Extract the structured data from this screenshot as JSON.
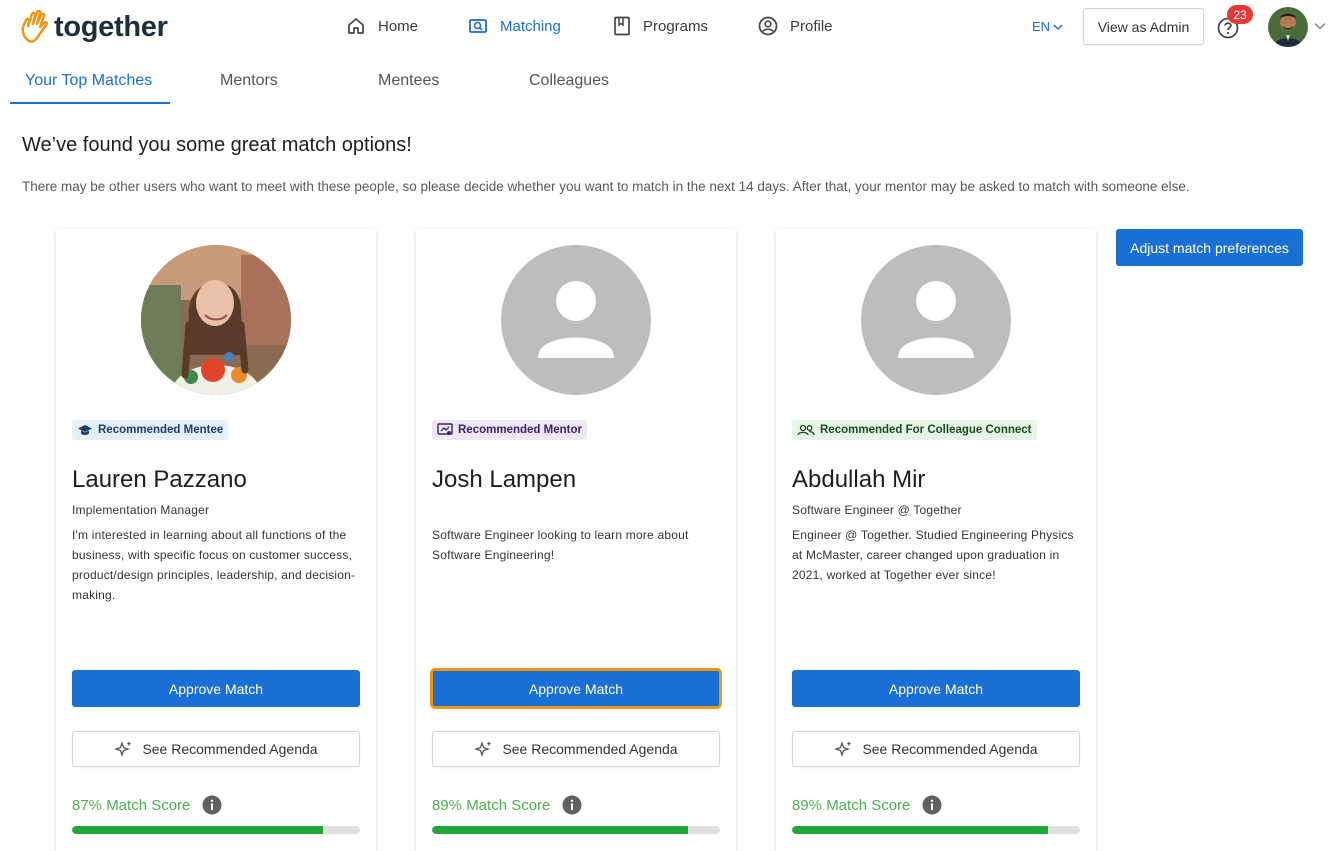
{
  "brand": {
    "name": "together",
    "accent": "#1a6fd4",
    "logo_color": "#f0950f"
  },
  "nav": {
    "items": [
      {
        "label": "Home",
        "icon": "home-icon",
        "active": false
      },
      {
        "label": "Matching",
        "icon": "matching-icon",
        "active": true
      },
      {
        "label": "Programs",
        "icon": "book-icon",
        "active": false
      },
      {
        "label": "Profile",
        "icon": "profile-icon",
        "active": false
      }
    ],
    "language": "EN",
    "admin_button": "View as Admin",
    "notification_count": "23"
  },
  "tabs": [
    {
      "label": "Your Top Matches",
      "active": true
    },
    {
      "label": "Mentors",
      "active": false
    },
    {
      "label": "Mentees",
      "active": false
    },
    {
      "label": "Colleagues",
      "active": false
    }
  ],
  "main": {
    "headline": "We’ve found you some great match options!",
    "subline": "There may be other users who want to meet with these people, so please decide whether you want to match in the next 14 days. After that, your mentor may be asked to match with someone else.",
    "adjust_button": "Adjust match preferences"
  },
  "cards": [
    {
      "tag": "Recommended Mentee",
      "tag_icon": "graduation-cap-icon",
      "name": "Lauren Pazzano",
      "role": "Implementation Manager",
      "bio": "I'm interested in learning about all functions of the business, with specific focus on customer success, product/design principles, leadership, and decision-making.",
      "approve_label": "Approve Match",
      "agenda_label": "See Recommended Agenda",
      "score_label": "87% Match Score",
      "score": 0.87,
      "has_photo": true
    },
    {
      "tag": "Recommended Mentor",
      "tag_icon": "presentation-icon",
      "name": "Josh Lampen",
      "role": "",
      "bio": "Software Engineer looking to learn more about Software Engineering!",
      "approve_label": "Approve Match",
      "agenda_label": "See Recommended Agenda",
      "score_label": "89% Match Score",
      "score": 0.89,
      "has_photo": false
    },
    {
      "tag": "Recommended For Colleague Connect",
      "tag_icon": "people-icon",
      "name": "Abdullah Mir",
      "role": "Software Engineer @ Together",
      "bio": "Engineer @ Together. Studied Engineering Physics at McMaster, career changed upon graduation in 2021, worked at Together ever since!",
      "approve_label": "Approve Match",
      "agenda_label": "See Recommended Agenda",
      "score_label": "89% Match Score",
      "score": 0.89,
      "has_photo": false
    }
  ]
}
